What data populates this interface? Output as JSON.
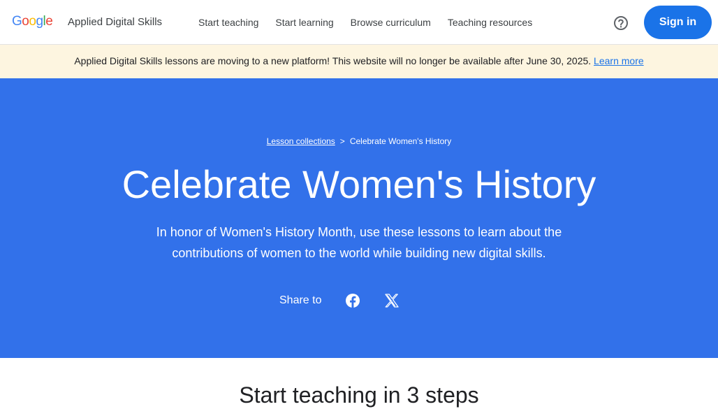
{
  "header": {
    "logo": {
      "letters": [
        "G",
        "o",
        "o",
        "g",
        "l",
        "e"
      ],
      "colors": [
        "#4285F4",
        "#EA4335",
        "#FBBC05",
        "#4285F4",
        "#34A853",
        "#EA4335"
      ]
    },
    "product_name": "Applied Digital Skills",
    "nav": [
      {
        "label": "Start teaching"
      },
      {
        "label": "Start learning"
      },
      {
        "label": "Browse curriculum"
      },
      {
        "label": "Teaching resources"
      }
    ],
    "help_icon": "help-circle-icon",
    "sign_in_label": "Sign in"
  },
  "banner": {
    "message": "Applied Digital Skills lessons are moving to a new platform! This website will no longer be available after June 30, 2025.",
    "link_label": "Learn more"
  },
  "hero": {
    "breadcrumb": {
      "parent": "Lesson collections",
      "separator": ">",
      "current": "Celebrate Women's History"
    },
    "title": "Celebrate Women's History",
    "description": "In honor of Women's History Month, use these lessons to learn about the contributions of women to the world while building new digital skills.",
    "share_label": "Share to",
    "share_icons": [
      "facebook-icon",
      "x-icon"
    ]
  },
  "section": {
    "title": "Start teaching in 3 steps"
  },
  "colors": {
    "brand_blue": "#1a73e8",
    "hero_blue": "#3271ea",
    "banner_bg": "#fdf5e0"
  }
}
